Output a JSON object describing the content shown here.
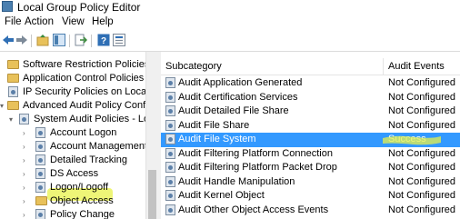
{
  "window": {
    "title": "Local Group Policy Editor"
  },
  "menu": [
    "File",
    "Action",
    "View",
    "Help"
  ],
  "toolbar": [
    "back-icon",
    "forward-icon",
    "up-folder-icon",
    "show-hide-tree-icon",
    "export-list-icon",
    "help-icon",
    "properties-icon"
  ],
  "tree": [
    {
      "label": "Software Restriction Policies",
      "type": "folder"
    },
    {
      "label": "Application Control Policies",
      "type": "folder"
    },
    {
      "label": "IP Security Policies on Local Co",
      "type": "policy"
    },
    {
      "label": "Advanced Audit Policy Configu",
      "type": "folder"
    },
    {
      "label": "System Audit Policies - Loca",
      "type": "policy"
    },
    {
      "label": "Account Logon",
      "type": "policy"
    },
    {
      "label": "Account Management",
      "type": "policy"
    },
    {
      "label": "Detailed Tracking",
      "type": "policy"
    },
    {
      "label": "DS Access",
      "type": "policy"
    },
    {
      "label": "Logon/Logoff",
      "type": "policy"
    },
    {
      "label": "Object Access",
      "type": "folder"
    },
    {
      "label": "Policy Change",
      "type": "policy"
    }
  ],
  "table": {
    "headers": [
      "Subcategory",
      "Audit Events"
    ],
    "rows": [
      {
        "name": "Audit Application Generated",
        "value": "Not Configured"
      },
      {
        "name": "Audit Certification Services",
        "value": "Not Configured"
      },
      {
        "name": "Audit Detailed File Share",
        "value": "Not Configured"
      },
      {
        "name": "Audit File Share",
        "value": "Not Configured"
      },
      {
        "name": "Audit File System",
        "value": "Success"
      },
      {
        "name": "Audit Filtering Platform Connection",
        "value": "Not Configured"
      },
      {
        "name": "Audit Filtering Platform Packet Drop",
        "value": "Not Configured"
      },
      {
        "name": "Audit Handle Manipulation",
        "value": "Not Configured"
      },
      {
        "name": "Audit Kernel Object",
        "value": "Not Configured"
      },
      {
        "name": "Audit Other Object Access Events",
        "value": "Not Configured"
      }
    ]
  },
  "colors": {
    "selection": "#3399ff",
    "highlighter": "#e8f24a"
  }
}
